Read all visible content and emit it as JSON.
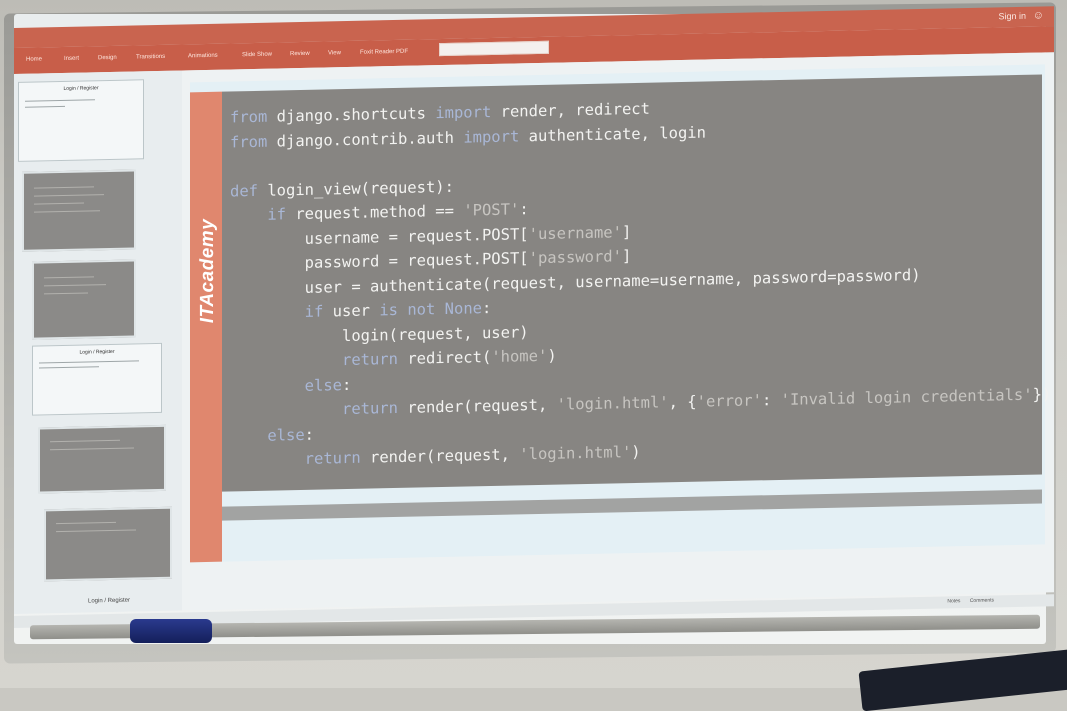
{
  "app": {
    "sign_in": "Sign in",
    "user_icon": "person-icon",
    "ribbon_tabs": [
      "Home",
      "Insert",
      "Design",
      "Transitions",
      "Animations",
      "Slide Show",
      "Review",
      "View",
      "Foxit Reader PDF"
    ]
  },
  "thumbnails": [
    {
      "kind": "text",
      "title": "Login / Register"
    },
    {
      "kind": "code"
    },
    {
      "kind": "code"
    },
    {
      "kind": "text",
      "title": "Login / Register"
    },
    {
      "kind": "code"
    },
    {
      "kind": "code"
    },
    {
      "kind": "text",
      "title": "Login / Register"
    }
  ],
  "slide": {
    "brand": "ITAcademy",
    "code_lines": [
      [
        [
          "kw",
          "from "
        ],
        [
          "txt",
          "django.shortcuts "
        ],
        [
          "kw",
          "import "
        ],
        [
          "txt",
          "render, redirect"
        ]
      ],
      [
        [
          "kw",
          "from "
        ],
        [
          "txt",
          "django.contrib.auth "
        ],
        [
          "kw",
          "import "
        ],
        [
          "txt",
          "authenticate, login"
        ]
      ],
      [],
      [
        [
          "kw",
          "def "
        ],
        [
          "txt",
          "login_view(request):"
        ]
      ],
      [
        [
          "txt",
          "    "
        ],
        [
          "kw",
          "if "
        ],
        [
          "txt",
          "request.method == "
        ],
        [
          "str",
          "'POST'"
        ],
        [
          "txt",
          ":"
        ]
      ],
      [
        [
          "txt",
          "        username = request.POST["
        ],
        [
          "str",
          "'username'"
        ],
        [
          "txt",
          "]"
        ]
      ],
      [
        [
          "txt",
          "        password = request.POST["
        ],
        [
          "str",
          "'password'"
        ],
        [
          "txt",
          "]"
        ]
      ],
      [
        [
          "txt",
          "        user = authenticate(request, username=username, password=password)"
        ]
      ],
      [
        [
          "txt",
          "        "
        ],
        [
          "kw",
          "if "
        ],
        [
          "txt",
          "user "
        ],
        [
          "kw",
          "is not "
        ],
        [
          "kw",
          "None"
        ],
        [
          "txt",
          ":"
        ]
      ],
      [
        [
          "txt",
          "            login(request, user)"
        ]
      ],
      [
        [
          "txt",
          "            "
        ],
        [
          "kw",
          "return "
        ],
        [
          "txt",
          "redirect("
        ],
        [
          "str",
          "'home'"
        ],
        [
          "txt",
          ")"
        ]
      ],
      [
        [
          "txt",
          "        "
        ],
        [
          "kw",
          "else"
        ],
        [
          "txt",
          ":"
        ]
      ],
      [
        [
          "txt",
          "            "
        ],
        [
          "kw",
          "return "
        ],
        [
          "txt",
          "render(request, "
        ],
        [
          "str",
          "'login.html'"
        ],
        [
          "txt",
          ", {"
        ],
        [
          "str",
          "'error'"
        ],
        [
          "txt",
          ": "
        ],
        [
          "str",
          "'Invalid login credentials'"
        ],
        [
          "txt",
          "})"
        ]
      ],
      [
        [
          "txt",
          "    "
        ],
        [
          "kw",
          "else"
        ],
        [
          "txt",
          ":"
        ]
      ],
      [
        [
          "txt",
          "        "
        ],
        [
          "kw",
          "return "
        ],
        [
          "txt",
          "render(request, "
        ],
        [
          "str",
          "'login.html'"
        ],
        [
          "txt",
          ")"
        ]
      ]
    ]
  },
  "status": {
    "notes": "Notes",
    "comments": "Comments"
  }
}
